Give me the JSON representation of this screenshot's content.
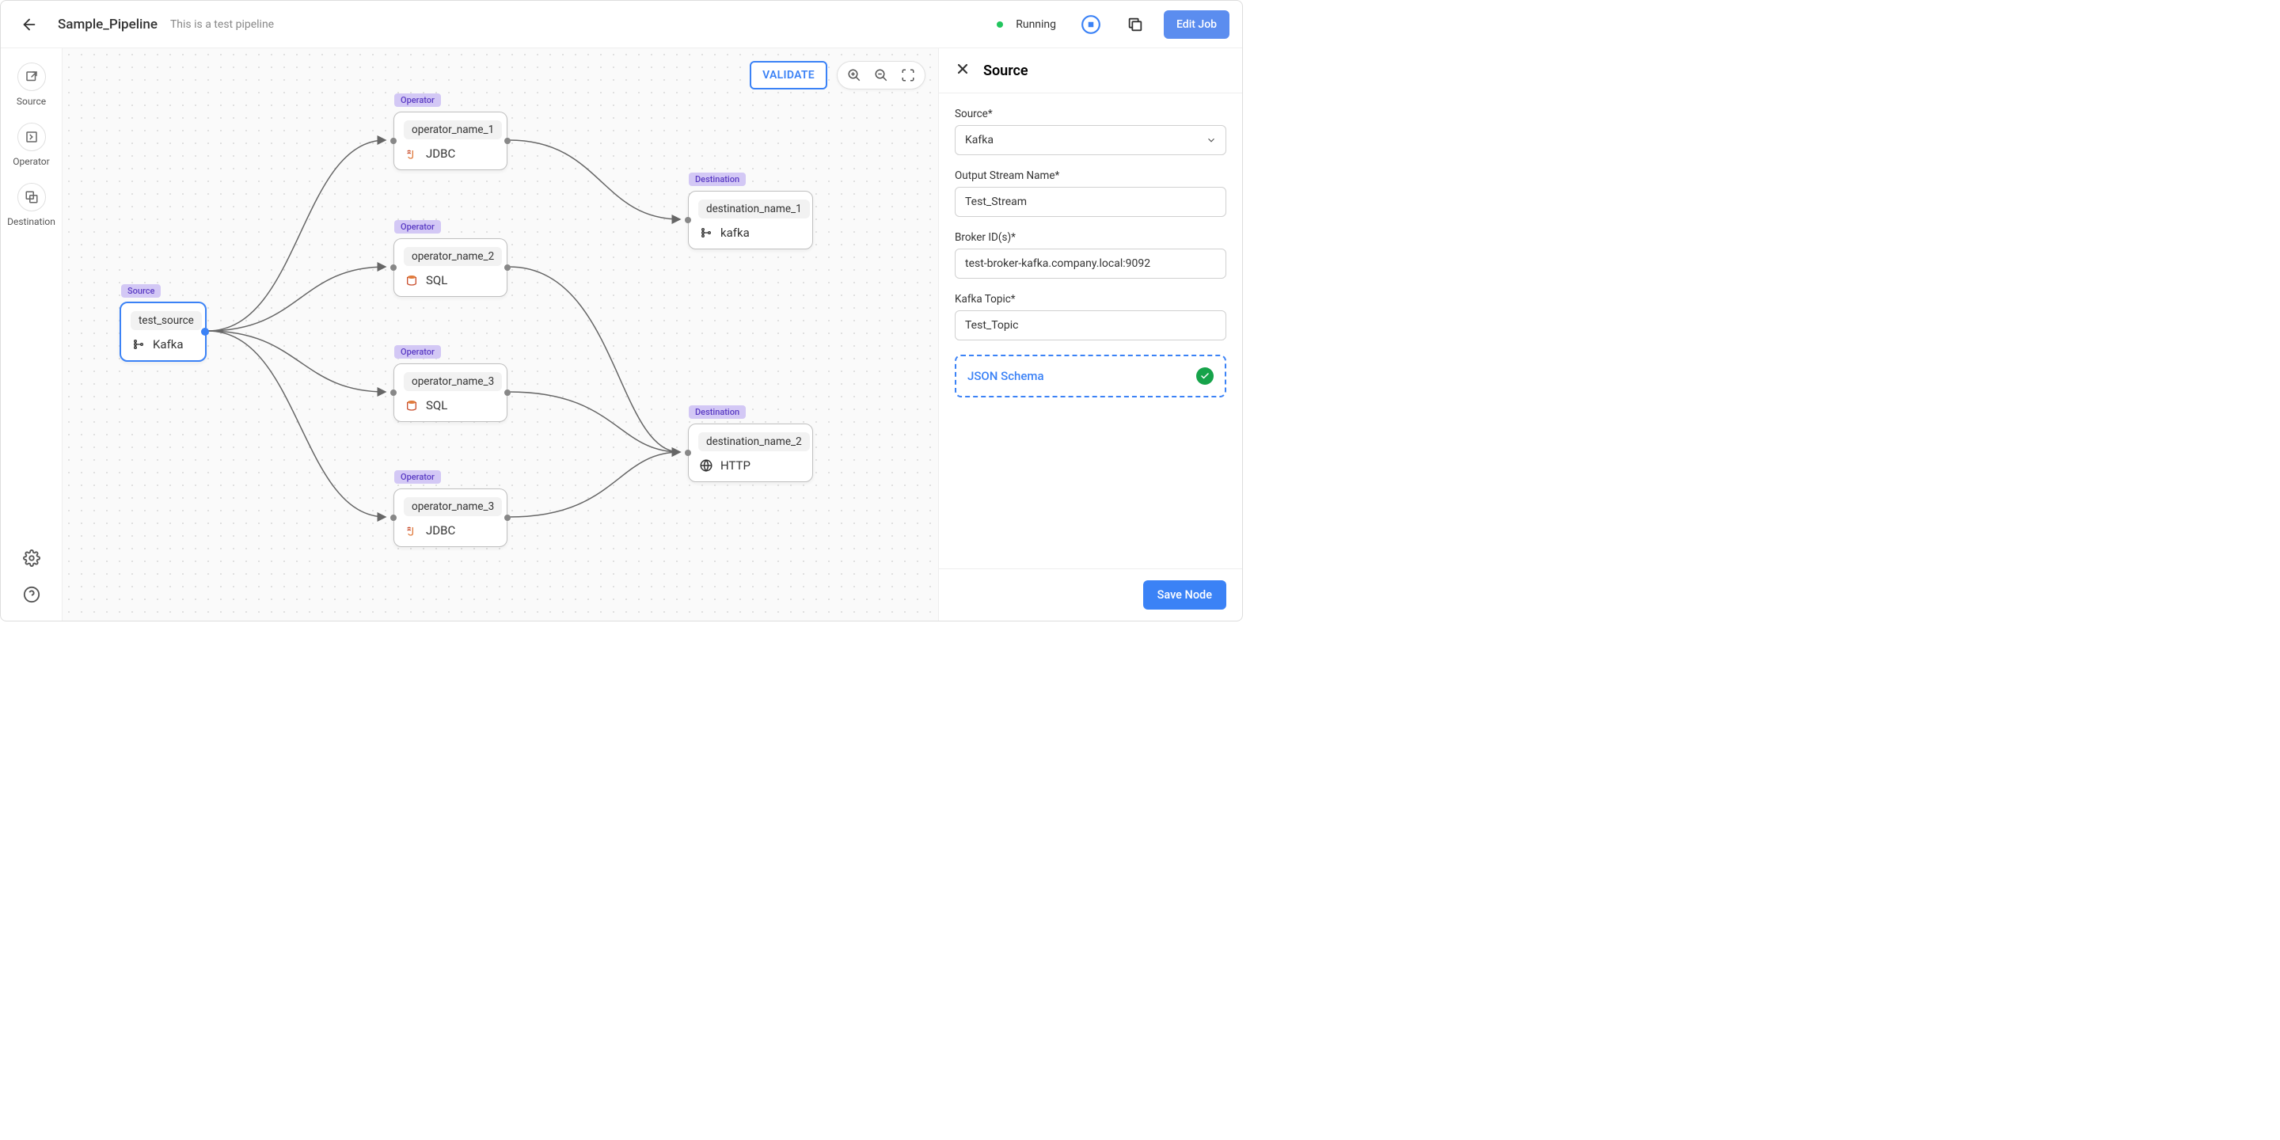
{
  "header": {
    "title": "Sample_Pipeline",
    "subtitle": "This is a test pipeline",
    "status": "Running",
    "edit_label": "Edit Job"
  },
  "sidebar": {
    "items": [
      {
        "label": "Source"
      },
      {
        "label": "Operator"
      },
      {
        "label": "Destination"
      }
    ]
  },
  "canvas": {
    "validate_label": "VALIDATE",
    "nodes": {
      "source": {
        "badge": "Source",
        "name": "test_source",
        "tech": "Kafka"
      },
      "op1": {
        "badge": "Operator",
        "name": "operator_name_1",
        "tech": "JDBC"
      },
      "op2": {
        "badge": "Operator",
        "name": "operator_name_2",
        "tech": "SQL"
      },
      "op3": {
        "badge": "Operator",
        "name": "operator_name_3",
        "tech": "SQL"
      },
      "op4": {
        "badge": "Operator",
        "name": "operator_name_3",
        "tech": "JDBC"
      },
      "dest1": {
        "badge": "Destination",
        "name": "destination_name_1",
        "tech": "kafka"
      },
      "dest2": {
        "badge": "Destination",
        "name": "destination_name_2",
        "tech": "HTTP"
      }
    }
  },
  "panel": {
    "title": "Source",
    "fields": {
      "source_label": "Source*",
      "source_value": "Kafka",
      "stream_label": "Output Stream Name*",
      "stream_value": "Test_Stream",
      "broker_label": "Broker ID(s)*",
      "broker_value": "test-broker-kafka.company.local:9092",
      "topic_label": "Kafka Topic*",
      "topic_value": "Test_Topic",
      "schema_label": "JSON Schema"
    },
    "save_label": "Save Node"
  }
}
